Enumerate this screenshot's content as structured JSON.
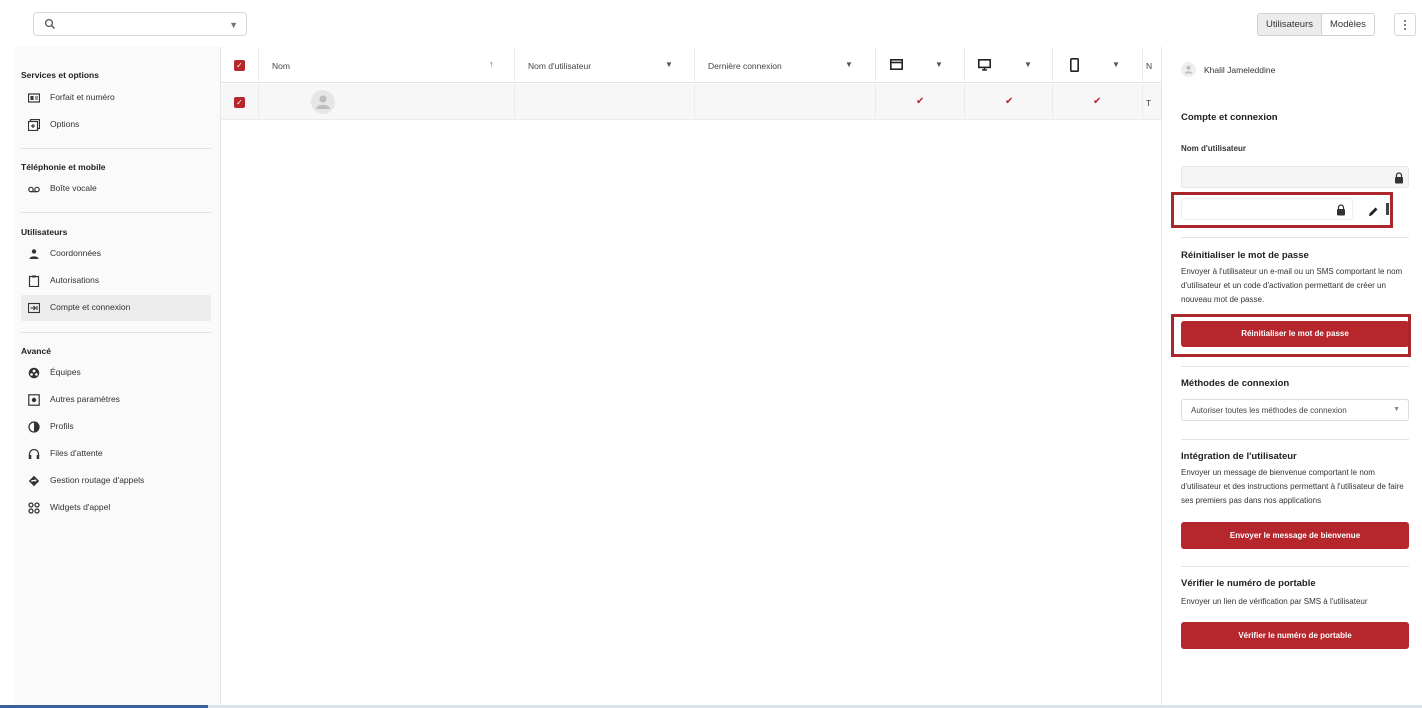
{
  "topbar": {
    "search_placeholder": "",
    "view_options": [
      "Utilisateurs",
      "Modèles"
    ],
    "active_view": "Utilisateurs"
  },
  "sidebar": {
    "sections": [
      {
        "title": "Services et options",
        "items": [
          {
            "label": "Forfait et numéro",
            "icon": "plan-card-icon"
          },
          {
            "label": "Options",
            "icon": "options-icon"
          }
        ]
      },
      {
        "title": "Téléphonie et mobile",
        "items": [
          {
            "label": "Boîte vocale",
            "icon": "voicemail-icon"
          }
        ]
      },
      {
        "title": "Utilisateurs",
        "items": [
          {
            "label": "Coordonnées",
            "icon": "person-icon"
          },
          {
            "label": "Autorisations",
            "icon": "clipboard-icon"
          },
          {
            "label": "Compte et connexion",
            "icon": "login-icon",
            "active": true
          }
        ]
      },
      {
        "title": "Avancé",
        "items": [
          {
            "label": "Équipes",
            "icon": "teams-icon"
          },
          {
            "label": "Autres paramètres",
            "icon": "settings-box-icon"
          },
          {
            "label": "Profils",
            "icon": "profile-contrast-icon"
          },
          {
            "label": "Files d'attente",
            "icon": "headset-icon"
          },
          {
            "label": "Gestion routage d'appels",
            "icon": "routing-icon"
          },
          {
            "label": "Widgets d'appel",
            "icon": "widgets-icon"
          }
        ]
      }
    ]
  },
  "table": {
    "columns": [
      "Nom",
      "Nom d'utilisateur",
      "Dernière connexion",
      "",
      "",
      "",
      "N"
    ],
    "rows": [
      {
        "name": "",
        "username": "",
        "last_login": "",
        "desktop": "✔",
        "web": "✔",
        "mobile": "✔",
        "last": "T"
      }
    ]
  },
  "panel": {
    "user_name": "Khalil Jameleddine",
    "account_title": "Compte et connexion",
    "username_label": "Nom d'utilisateur",
    "reset_title": "Réinitialiser le mot de passe",
    "reset_text": "Envoyer à l'utilisateur un e-mail ou un SMS comportant le nom d'utilisateur et un code d'activation permettant de créer un nouveau mot de passe.",
    "reset_button": "Réinitialiser le mot de passe",
    "methods_title": "Méthodes de connexion",
    "methods_value": "Autoriser toutes les méthodes de connexion",
    "onboarding_title": "Intégration de l'utilisateur",
    "onboarding_text": "Envoyer un message de bienvenue comportant le nom d'utilisateur et des instructions permettant à l'utilisateur de faire ses premiers pas dans nos applications",
    "onboarding_button": "Envoyer le message de bienvenue",
    "verify_title": "Vérifier le numéro de portable",
    "verify_text": "Envoyer un lien de vérification par SMS à l'utilisateur",
    "verify_button": "Vérifier le numéro de portable"
  },
  "colors": {
    "accent": "#b5262d",
    "highlight": "#a9272b"
  }
}
